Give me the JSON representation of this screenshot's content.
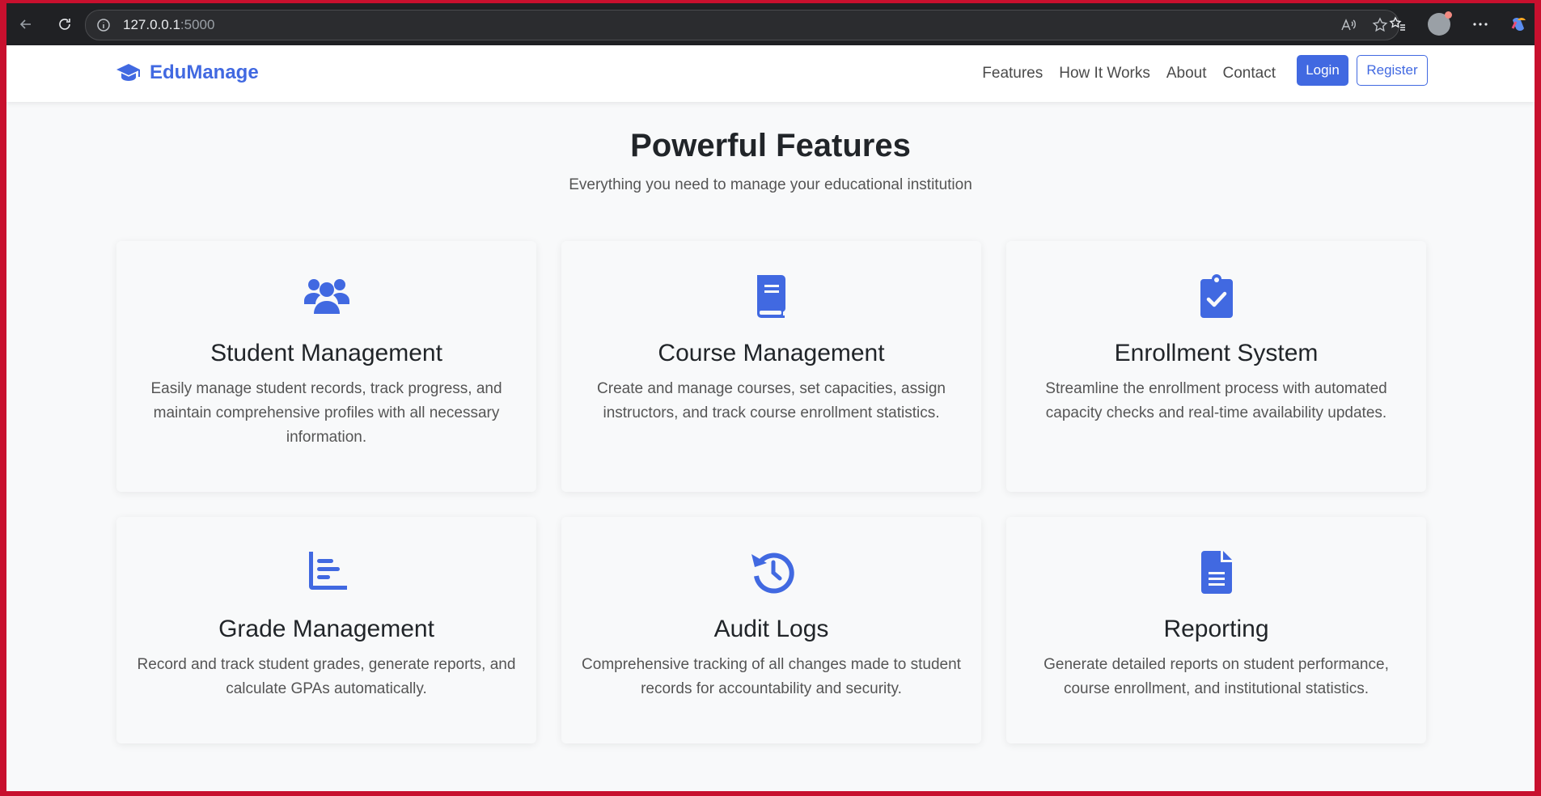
{
  "browser": {
    "url_host": "127.0.0.1",
    "url_port": ":5000"
  },
  "nav": {
    "brand": "EduManage",
    "links": [
      "Features",
      "How It Works",
      "About",
      "Contact"
    ],
    "login": "Login",
    "register": "Register"
  },
  "hero": {
    "title": "Powerful Features",
    "subtitle": "Everything you need to manage your educational institution"
  },
  "features": [
    {
      "icon": "users-icon",
      "title": "Student Management",
      "text": "Easily manage student records, track progress, and maintain comprehensive profiles with all necessary information."
    },
    {
      "icon": "book-icon",
      "title": "Course Management",
      "text": "Create and manage courses, set capacities, assign instructors, and track course enrollment statistics."
    },
    {
      "icon": "clipboard-check-icon",
      "title": "Enrollment System",
      "text": "Streamline the enrollment process with automated capacity checks and real-time availability updates."
    },
    {
      "icon": "chart-bar-icon",
      "title": "Grade Management",
      "text": "Record and track student grades, generate reports, and calculate GPAs automatically."
    },
    {
      "icon": "history-icon",
      "title": "Audit Logs",
      "text": "Comprehensive tracking of all changes made to student records for accountability and security."
    },
    {
      "icon": "file-alt-icon",
      "title": "Reporting",
      "text": "Generate detailed reports on student performance, course enrollment, and institutional statistics."
    }
  ],
  "colors": {
    "accent": "#4169e1",
    "frame": "#c8102e"
  }
}
